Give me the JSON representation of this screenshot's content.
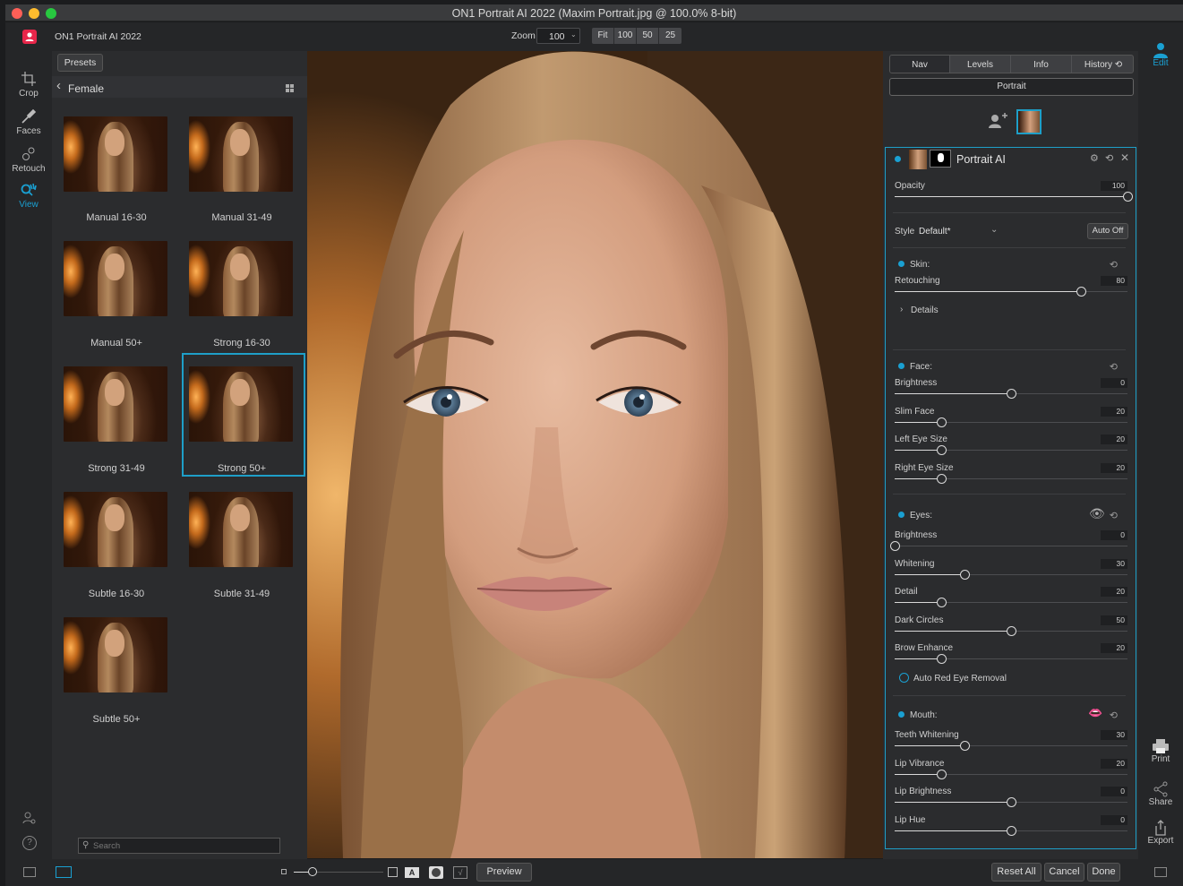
{
  "window": {
    "title": "ON1 Portrait AI 2022 (Maxim Portrait.jpg @ 100.0% 8-bit)"
  },
  "app": {
    "name": "ON1 Portrait AI 2022",
    "zoom_label": "Zoom",
    "zoom_value": "100",
    "zoom_presets": [
      "Fit",
      "100",
      "50",
      "25"
    ]
  },
  "tools": [
    {
      "label": "Crop",
      "icon": "crop-icon"
    },
    {
      "label": "Faces",
      "icon": "faces-brush-icon"
    },
    {
      "label": "Retouch",
      "icon": "retouch-icon"
    },
    {
      "label": "View",
      "icon": "view-hand-icon",
      "active": true
    }
  ],
  "presets": {
    "button": "Presets",
    "category": "Female",
    "search_placeholder": "Search",
    "items": [
      "Manual 16-30",
      "Manual 31-49",
      "Manual 50+",
      "Strong 16-30",
      "Strong 31-49",
      "Strong 50+",
      "Subtle 16-30",
      "Subtle 31-49",
      "Subtle 50+"
    ],
    "selected": "Strong 50+"
  },
  "panel": {
    "tabs": [
      "Nav",
      "Levels",
      "Info",
      "History"
    ],
    "mode": "Portrait",
    "layer_title": "Portrait AI",
    "opacity": {
      "label": "Opacity",
      "value": 100
    },
    "style": {
      "label": "Style",
      "value": "Default*",
      "auto_button": "Auto Off"
    },
    "skin": {
      "title": "Skin:",
      "sliders": [
        {
          "label": "Retouching",
          "value": 80
        }
      ],
      "details": "Details"
    },
    "face": {
      "title": "Face:",
      "sliders": [
        {
          "label": "Brightness",
          "value": 0,
          "pos": 0.5
        },
        {
          "label": "Slim Face",
          "value": 20,
          "pos": 0.2
        },
        {
          "label": "Left Eye Size",
          "value": 20,
          "pos": 0.2
        },
        {
          "label": "Right Eye Size",
          "value": 20,
          "pos": 0.2
        }
      ]
    },
    "eyes": {
      "title": "Eyes:",
      "sliders": [
        {
          "label": "Brightness",
          "value": 0,
          "pos": 0.0
        },
        {
          "label": "Whitening",
          "value": 30,
          "pos": 0.3
        },
        {
          "label": "Detail",
          "value": 20,
          "pos": 0.2
        },
        {
          "label": "Dark Circles",
          "value": 50,
          "pos": 0.5
        },
        {
          "label": "Brow Enhance",
          "value": 20,
          "pos": 0.2
        }
      ],
      "checkbox": "Auto Red Eye Removal"
    },
    "mouth": {
      "title": "Mouth:",
      "sliders": [
        {
          "label": "Teeth Whitening",
          "value": 30,
          "pos": 0.3
        },
        {
          "label": "Lip Vibrance",
          "value": 20,
          "pos": 0.2
        },
        {
          "label": "Lip Brightness",
          "value": 0,
          "pos": 0.5
        },
        {
          "label": "Lip Hue",
          "value": 0,
          "pos": 0.5
        }
      ]
    }
  },
  "right_tools": {
    "edit": "Edit",
    "print": "Print",
    "share": "Share",
    "export": "Export"
  },
  "bottom": {
    "preview": "Preview",
    "reset_all": "Reset All",
    "cancel": "Cancel",
    "done": "Done"
  },
  "colors": {
    "accent": "#1aa0d2",
    "selection": "#1e9fc8",
    "app_icon": "#e8264a"
  }
}
